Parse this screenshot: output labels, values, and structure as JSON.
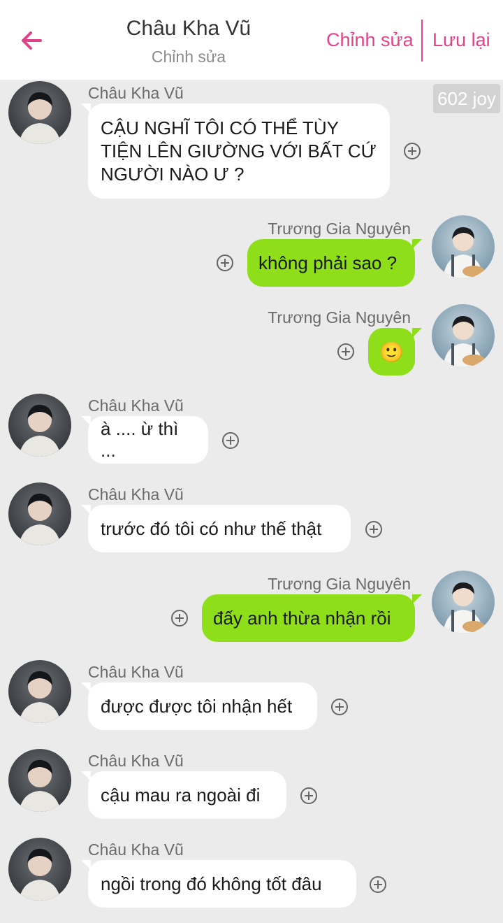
{
  "header": {
    "title": "Châu Kha Vũ",
    "subtitle": "Chỉnh sửa",
    "edit_label": "Chỉnh sửa",
    "save_label": "Lưu lại",
    "accent": "#e0438a"
  },
  "badge": {
    "joy": "602 joy"
  },
  "contacts": {
    "left_name": "Châu Kha Vũ",
    "right_name": "Trương Gia Nguyên"
  },
  "messages": [
    {
      "side": "left",
      "name": "Châu Kha Vũ",
      "text": "CẬU NGHĨ TÔI CÓ THỂ TÙY TIỆN LÊN GIƯỜNG VỚI BẤT CỨ NGƯỜI NÀO Ư ?"
    },
    {
      "side": "right",
      "name": "Trương Gia Nguyên",
      "text": "không phải sao ?"
    },
    {
      "side": "right",
      "name": "Trương Gia Nguyên",
      "text": "🙂"
    },
    {
      "side": "left",
      "name": "Châu Kha Vũ",
      "text": "à .... ừ thì ..."
    },
    {
      "side": "left",
      "name": "Châu Kha Vũ",
      "text": "trước đó tôi có như thế thật"
    },
    {
      "side": "right",
      "name": "Trương Gia Nguyên",
      "text": "đấy anh thừa nhận rồi"
    },
    {
      "side": "left",
      "name": "Châu Kha Vũ",
      "text": "được được tôi nhận hết"
    },
    {
      "side": "left",
      "name": "Châu Kha Vũ",
      "text": "cậu mau ra ngoài đi"
    },
    {
      "side": "left",
      "name": "Châu Kha Vũ",
      "text": "ngồi trong đó không tốt đâu"
    }
  ],
  "colors": {
    "sent_bubble": "#8edf1a",
    "received_bubble": "#ffffff",
    "background": "#ebebeb"
  }
}
